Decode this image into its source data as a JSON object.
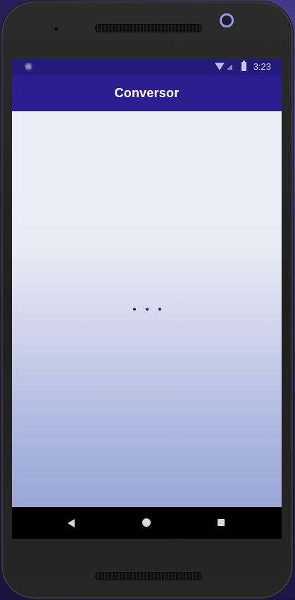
{
  "status_bar": {
    "time": "3:23",
    "icons": [
      "notification-dot-icon",
      "wifi-icon",
      "cell-signal-icon",
      "battery-icon"
    ]
  },
  "app_bar": {
    "title": "Conversor"
  },
  "content": {
    "loading_indicator": "three-dots"
  },
  "nav_bar": {
    "icons": [
      "back-icon",
      "home-icon",
      "recents-icon"
    ]
  },
  "colors": {
    "status_bar": "#241a7a",
    "app_bar": "#2c1d91",
    "accent": "#2c1d91",
    "content_top": "#eceef7",
    "content_bottom": "#9ba6d8"
  }
}
